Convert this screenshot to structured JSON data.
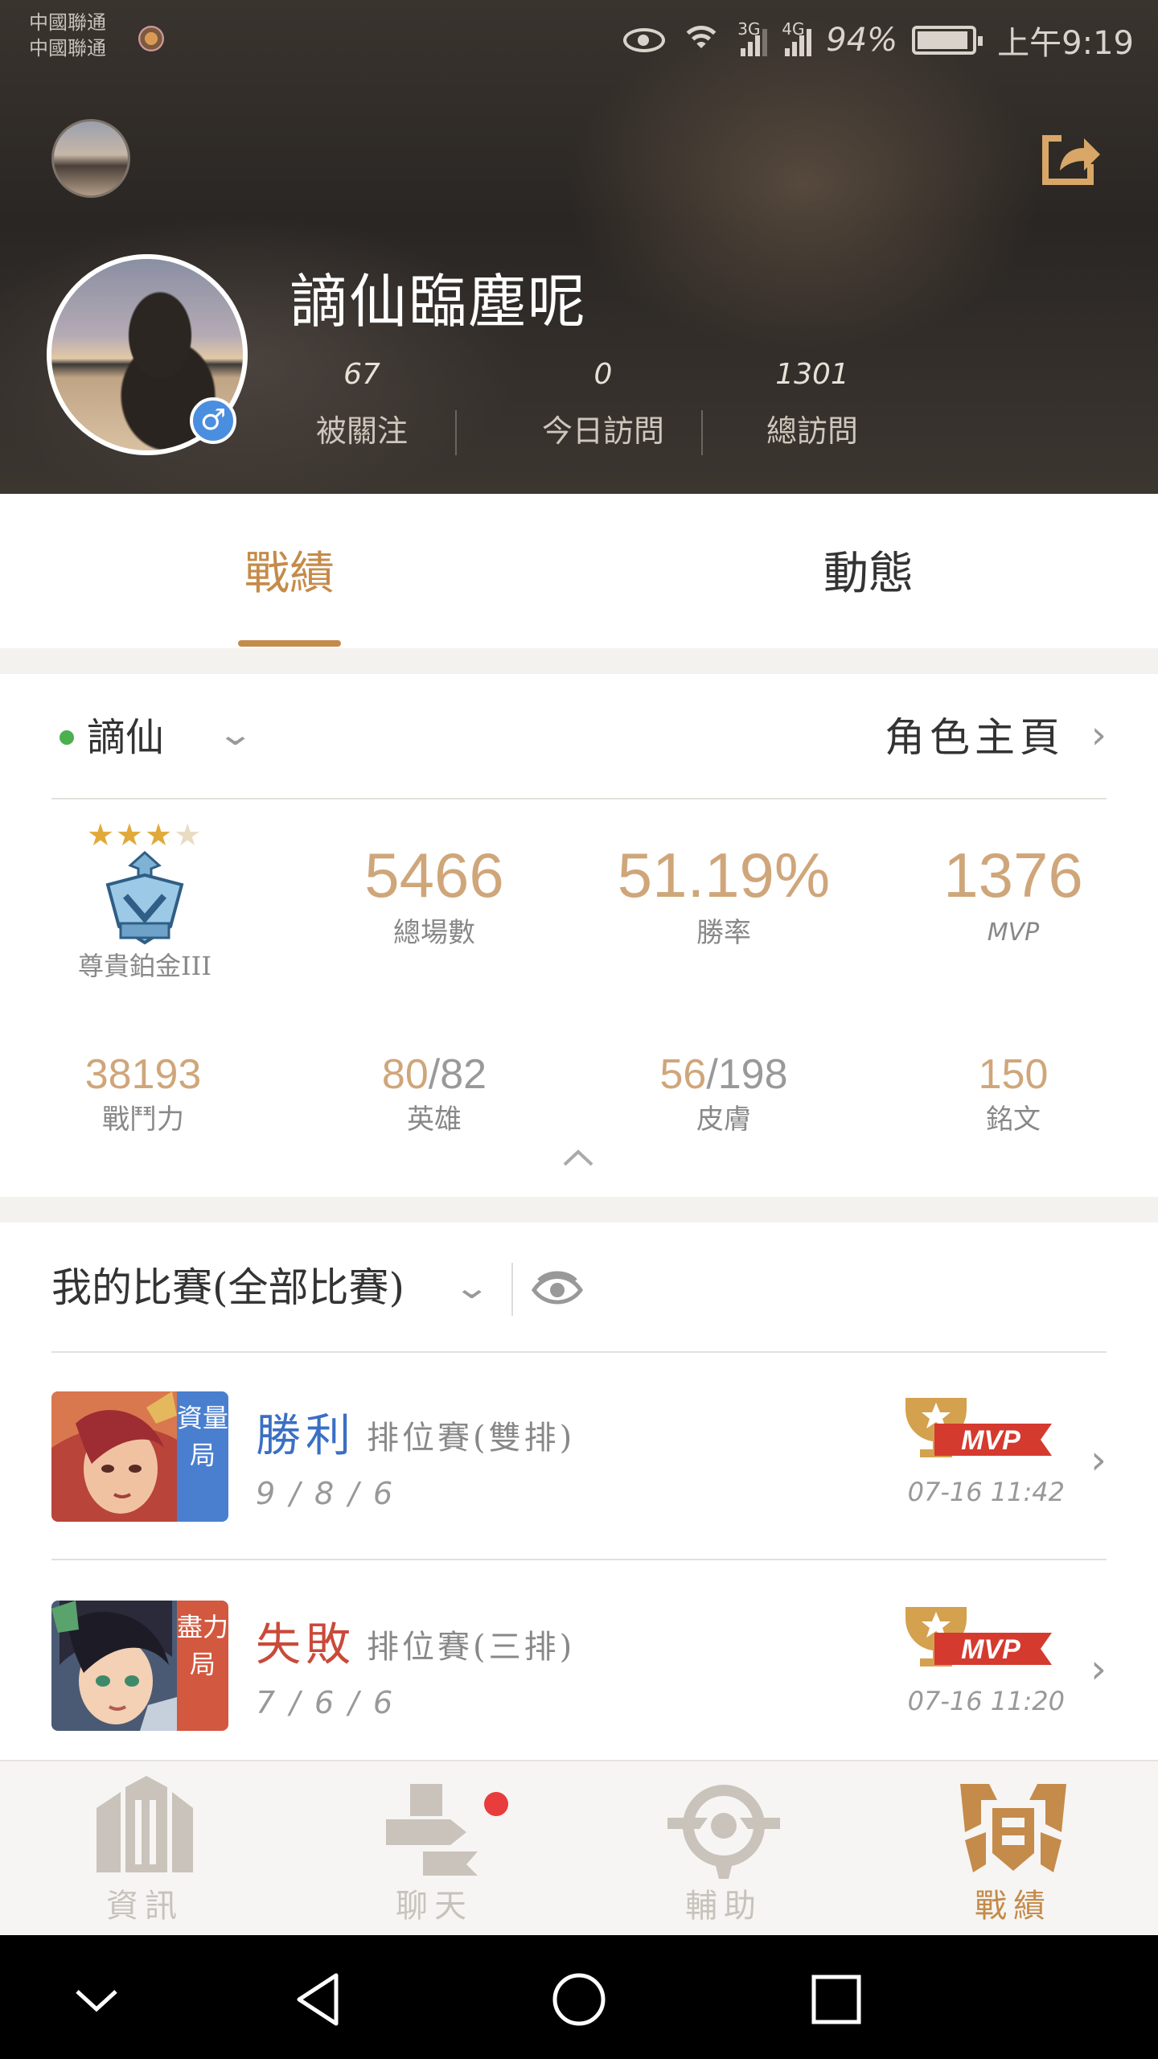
{
  "status_bar": {
    "carrier_line1": "中國聯通",
    "carrier_line2": "中國聯通",
    "network_a": "3G",
    "network_b": "4G",
    "battery": "94%",
    "time": "上午9:19"
  },
  "profile": {
    "nickname": "謫仙臨塵呢",
    "stats": [
      {
        "value": "67",
        "label": "被關注"
      },
      {
        "value": "0",
        "label": "今日訪問"
      },
      {
        "value": "1301",
        "label": "總訪問"
      }
    ]
  },
  "tabs": [
    {
      "label": "戰績",
      "active": true
    },
    {
      "label": "動態",
      "active": false
    }
  ],
  "role": {
    "name": "謫仙",
    "home_label": "角色主頁",
    "rank_name": "尊貴鉑金III",
    "rank_stars": 3,
    "rank_stars_total": 4
  },
  "summary": {
    "total_games": {
      "value": "5466",
      "label": "總場數"
    },
    "win_rate": {
      "value": "51.19%",
      "label": "勝率"
    },
    "mvp": {
      "value": "1376",
      "label": "MVP"
    },
    "power": {
      "value": "38193",
      "label": "戰鬥力"
    },
    "heroes": {
      "owned": "80",
      "total": "/82",
      "label": "英雄"
    },
    "skins": {
      "owned": "56",
      "total": "/198",
      "label": "皮膚"
    },
    "runes": {
      "value": "150",
      "label": "銘文"
    }
  },
  "matches": {
    "filter_label": "我的比賽(全部比賽)",
    "items": [
      {
        "result": "勝利",
        "result_color": "#3a6fc4",
        "mode": "排位賽(雙排)",
        "tag": "資量局",
        "tag_color": "#4a7fd0",
        "kda": "9/8/6",
        "badge": "MVP",
        "time": "07-16 11:42"
      },
      {
        "result": "失敗",
        "result_color": "#c94a3a",
        "mode": "排位賽(三排)",
        "tag": "盡力局",
        "tag_color": "#d2583f",
        "kda": "7/6/6",
        "badge": "MVP",
        "time": "07-16 11:20"
      }
    ]
  },
  "bottom_nav": [
    {
      "label": "資訊",
      "icon": "news-icon",
      "active": false
    },
    {
      "label": "聊天",
      "icon": "chat-icon",
      "active": false,
      "has_notification": true
    },
    {
      "label": "輔助",
      "icon": "assist-icon",
      "active": false
    },
    {
      "label": "戰績",
      "icon": "record-icon",
      "active": true
    }
  ],
  "colors": {
    "accent": "#c58b4a",
    "stat_value": "#cfa67a",
    "online": "#4caf50",
    "notification": "#e93c3c",
    "gender_badge": "#4a8ee0"
  }
}
